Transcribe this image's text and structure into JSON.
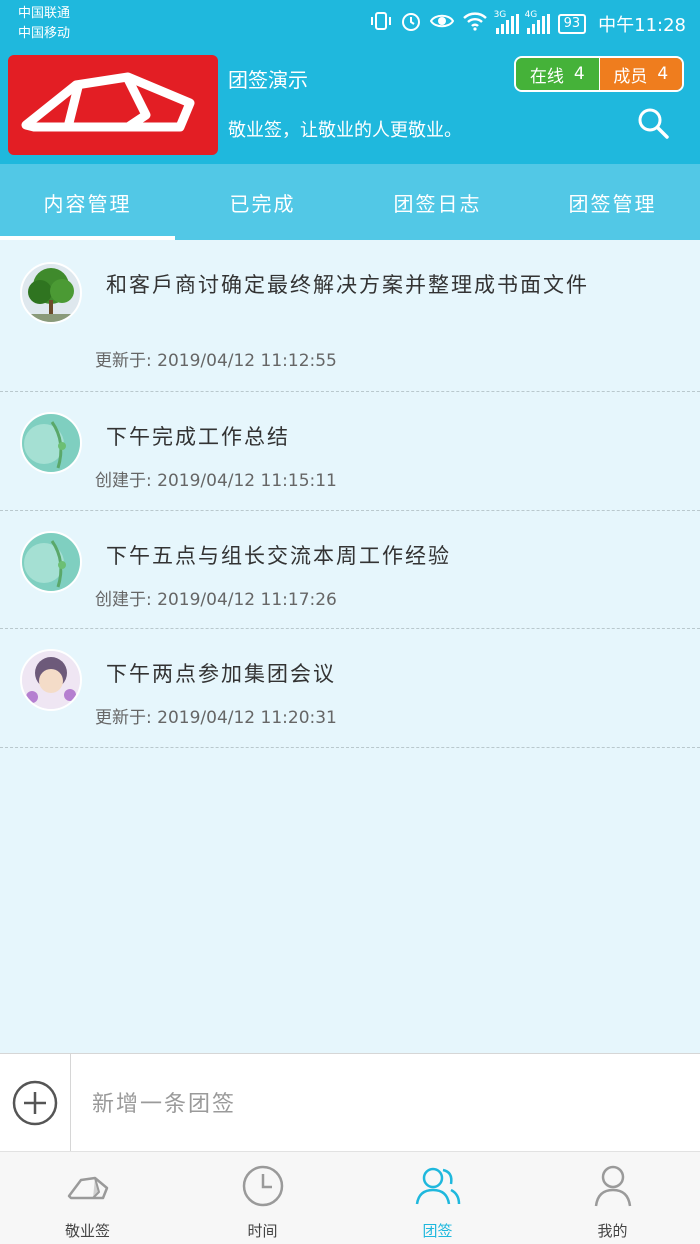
{
  "status_bar": {
    "carrier1": "中国联通",
    "carrier2": "中国移动",
    "net1": "3G",
    "net2": "4G",
    "battery": "93",
    "time": "中午11:28"
  },
  "header": {
    "team_name": "团签演示",
    "slogan": "敬业签，让敬业的人更敬业。",
    "online_label": "在线",
    "online_count": "4",
    "members_label": "成员",
    "members_count": "4"
  },
  "tabs": [
    {
      "label": "内容管理",
      "active": true
    },
    {
      "label": "已完成",
      "active": false
    },
    {
      "label": "团签日志",
      "active": false
    },
    {
      "label": "团签管理",
      "active": false
    }
  ],
  "items": [
    {
      "title": "和客戶商讨确定最终解决方案并整理成书面文件",
      "meta": "更新于: 2019/04/12  11:12:55"
    },
    {
      "title": "下午完成工作总结",
      "meta": "创建于: 2019/04/12  11:15:11"
    },
    {
      "title": "下午五点与组长交流本周工作经验",
      "meta": "创建于: 2019/04/12  11:17:26"
    },
    {
      "title": "下午两点参加集团会议",
      "meta": "更新于: 2019/04/12  11:20:31"
    }
  ],
  "composer": {
    "placeholder": "新增一条团签"
  },
  "nav": [
    {
      "label": "敬业签",
      "active": false
    },
    {
      "label": "时间",
      "active": false
    },
    {
      "label": "团签",
      "active": true
    },
    {
      "label": "我的",
      "active": false
    }
  ],
  "colors": {
    "primary": "#1fb8dd",
    "tab_bg": "#52c8e6",
    "online": "#45b239",
    "members": "#ef7d1e",
    "logo": "#e31e24"
  }
}
